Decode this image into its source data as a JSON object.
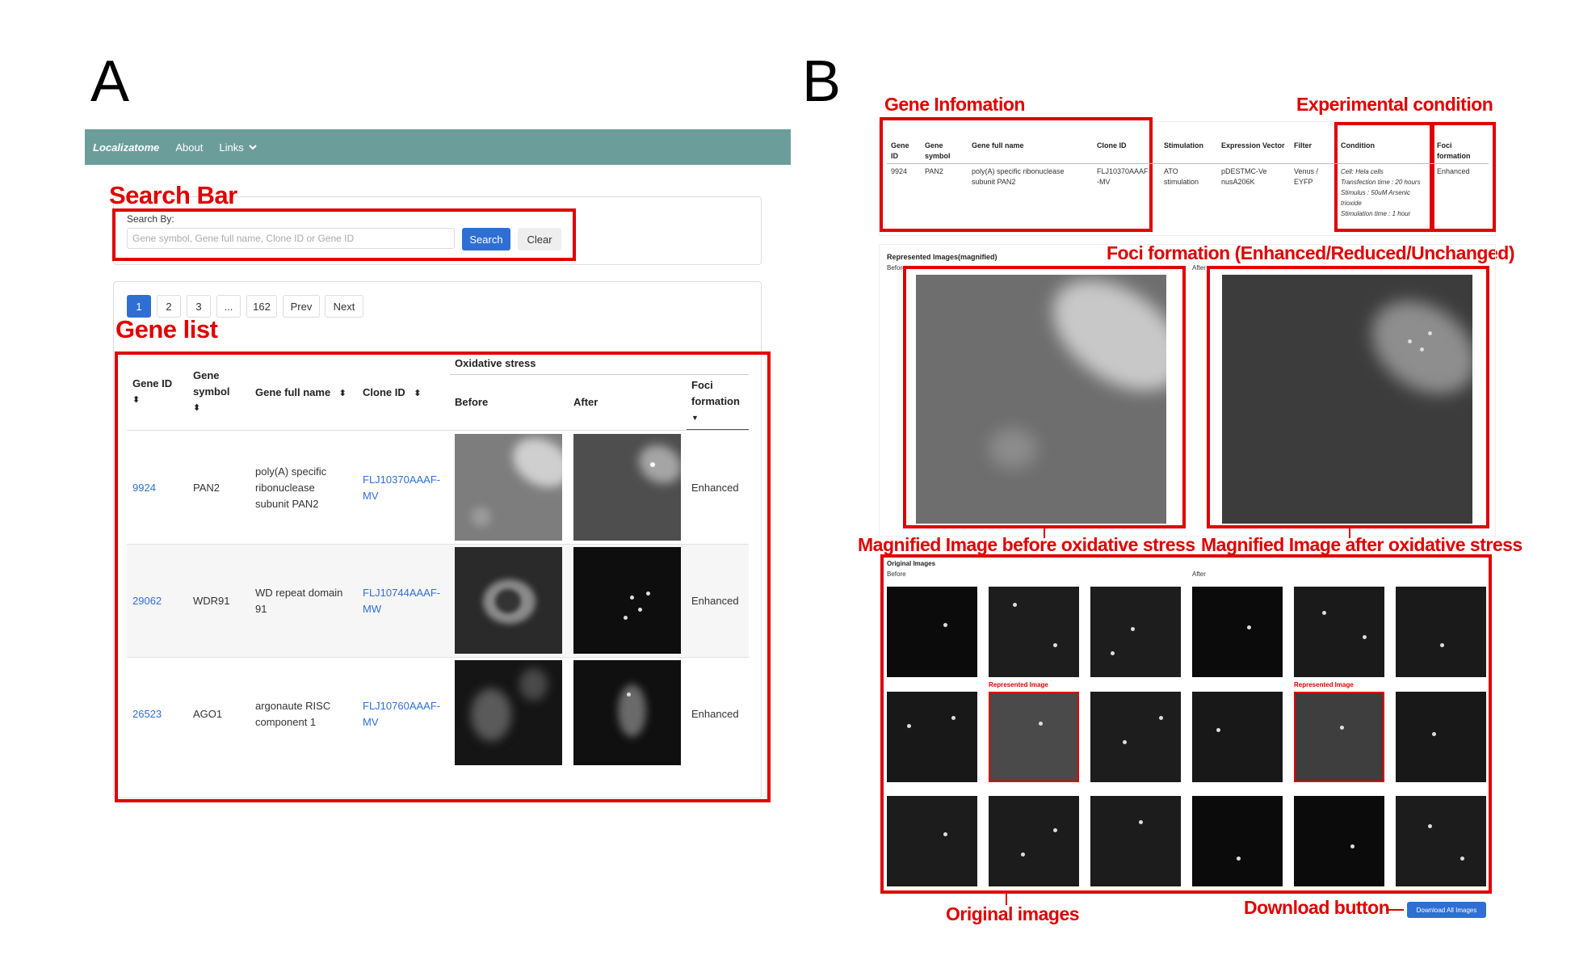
{
  "panels": {
    "a": "A",
    "b": "B"
  },
  "panel_a": {
    "navbar": {
      "brand": "Localizatome",
      "about": "About",
      "links": "Links"
    },
    "annotations": {
      "search_bar": "Search Bar",
      "gene_list": "Gene list"
    },
    "search": {
      "label": "Search By:",
      "placeholder": "Gene symbol, Gene full name, Clone ID or Gene ID",
      "search_button": "Search",
      "clear_button": "Clear"
    },
    "pagination": {
      "pages": [
        "1",
        "2",
        "3",
        "...",
        "162"
      ],
      "prev": "Prev",
      "next": "Next"
    },
    "table": {
      "group_header": "Oxidative stress",
      "headers": {
        "gene_id": "Gene ID",
        "gene_symbol": "Gene symbol",
        "gene_full_name": "Gene full name",
        "clone_id": "Clone ID",
        "before": "Before",
        "after": "After",
        "foci": "Foci formation"
      },
      "rows": [
        {
          "gene_id": "9924",
          "symbol": "PAN2",
          "full_name": "poly(A) specific ribonuclease subunit PAN2",
          "clone_id": "FLJ10370AAAF-MV",
          "foci": "Enhanced"
        },
        {
          "gene_id": "29062",
          "symbol": "WDR91",
          "full_name": "WD repeat domain 91",
          "clone_id": "FLJ10744AAAF-MW",
          "foci": "Enhanced"
        },
        {
          "gene_id": "26523",
          "symbol": "AGO1",
          "full_name": "argonaute RISC component 1",
          "clone_id": "FLJ10760AAAF-MV",
          "foci": "Enhanced"
        }
      ]
    }
  },
  "panel_b": {
    "annotations": {
      "gene_information": "Gene Infomation",
      "experimental_condition": "Experimental condition",
      "foci_formation": "Foci formation (Enhanced/Reduced/Unchanged)",
      "magnified_before": "Magnified Image before oxidative stress",
      "magnified_after": "Magnified Image after oxidative stress",
      "original_images": "Original images",
      "download_button": "Download button"
    },
    "detail_table": {
      "headers": {
        "gene_id": "Gene ID",
        "gene_symbol": "Gene symbol",
        "gene_full_name": "Gene full name",
        "clone_id": "Clone ID",
        "stimulation": "Stimulation",
        "expression_vector": "Expression Vector",
        "filter": "Filter",
        "condition": "Condition",
        "foci": "Foci formation"
      },
      "row": {
        "gene_id": "9924",
        "symbol": "PAN2",
        "full_name": "poly(A) specific ribonuclease subunit PAN2",
        "clone_id": "FLJ10370AAAF-MV",
        "stimulation": "ATO stimulation",
        "expression_vector": "pDESTMC-VenusA206K",
        "filter": "Venus / EYFP",
        "condition": [
          "Cell: Hela cells",
          "Transfection time : 20 hours",
          "Stimulus : 50uM Arsenic trioxide",
          "Stimulation time : 1 hour"
        ],
        "foci": "Enhanced"
      }
    },
    "represented_images": {
      "title": "Represented Images(magnified)",
      "before": "Before",
      "after": "After"
    },
    "original_images": {
      "title": "Original Images",
      "before": "Before",
      "after": "After",
      "represented_label": "Represented Image"
    },
    "download_button": "Download All Images"
  }
}
